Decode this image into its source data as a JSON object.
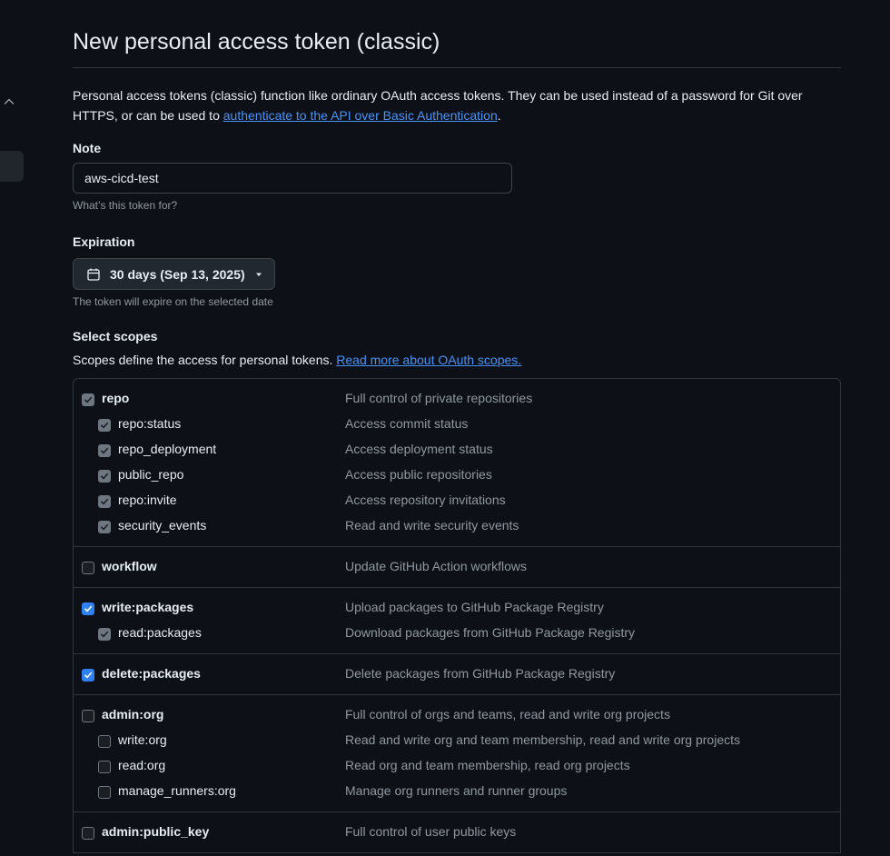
{
  "page": {
    "title": "New personal access token (classic)",
    "intro_text": "Personal access tokens (classic) function like ordinary OAuth access tokens. They can be used instead of a password for Git over HTTPS, or can be used to ",
    "intro_link": "authenticate to the API over Basic Authentication",
    "intro_end": "."
  },
  "note": {
    "label": "Note",
    "value": "aws-cicd-test",
    "hint": "What’s this token for?"
  },
  "expiration": {
    "label": "Expiration",
    "value": "30 days (Sep 13, 2025)",
    "hint": "The token will expire on the selected date"
  },
  "scopes": {
    "label": "Select scopes",
    "description": "Scopes define the access for personal tokens. ",
    "link": "Read more about OAuth scopes.",
    "groups": [
      {
        "parent": {
          "name": "repo",
          "desc": "Full control of private repositories",
          "state": "disabled"
        },
        "children": [
          {
            "name": "repo:status",
            "desc": "Access commit status",
            "state": "disabled"
          },
          {
            "name": "repo_deployment",
            "desc": "Access deployment status",
            "state": "disabled"
          },
          {
            "name": "public_repo",
            "desc": "Access public repositories",
            "state": "disabled"
          },
          {
            "name": "repo:invite",
            "desc": "Access repository invitations",
            "state": "disabled"
          },
          {
            "name": "security_events",
            "desc": "Read and write security events",
            "state": "disabled"
          }
        ]
      },
      {
        "parent": {
          "name": "workflow",
          "desc": "Update GitHub Action workflows",
          "state": "unchecked"
        },
        "children": []
      },
      {
        "parent": {
          "name": "write:packages",
          "desc": "Upload packages to GitHub Package Registry",
          "state": "checked"
        },
        "children": [
          {
            "name": "read:packages",
            "desc": "Download packages from GitHub Package Registry",
            "state": "disabled"
          }
        ]
      },
      {
        "parent": {
          "name": "delete:packages",
          "desc": "Delete packages from GitHub Package Registry",
          "state": "checked"
        },
        "children": []
      },
      {
        "parent": {
          "name": "admin:org",
          "desc": "Full control of orgs and teams, read and write org projects",
          "state": "unchecked"
        },
        "children": [
          {
            "name": "write:org",
            "desc": "Read and write org and team membership, read and write org projects",
            "state": "unchecked"
          },
          {
            "name": "read:org",
            "desc": "Read org and team membership, read org projects",
            "state": "unchecked"
          },
          {
            "name": "manage_runners:org",
            "desc": "Manage org runners and runner groups",
            "state": "unchecked"
          }
        ]
      },
      {
        "parent": {
          "name": "admin:public_key",
          "desc": "Full control of user public keys",
          "state": "unchecked"
        },
        "children": []
      }
    ]
  },
  "icons": {
    "sidebar_toggle": "chevron-up-icon",
    "calendar": "calendar-icon",
    "dropdown": "triangle-down-icon",
    "check": "check-icon"
  },
  "colors": {
    "background": "#0d1117",
    "link": "#4493f8",
    "checkbox_checked": "#2f81f7",
    "muted_text": "#9198a1",
    "border": "#30363d"
  }
}
